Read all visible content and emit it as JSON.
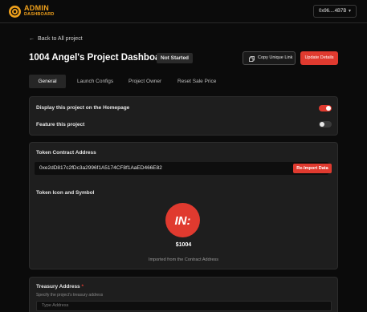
{
  "header": {
    "logo_title": "ADMIN",
    "logo_subtitle": "DASHBOARD",
    "wallet_address": "0x96....4B7B"
  },
  "nav": {
    "back_label": "Back to All project"
  },
  "project": {
    "title": "1004 Angel's Project Dashboard",
    "status": "Not Started",
    "copy_link_label": "Copy Unique Link",
    "update_label": "Update Details"
  },
  "tabs": [
    {
      "label": "General",
      "active": true
    },
    {
      "label": "Launch Configs",
      "active": false
    },
    {
      "label": "Project Owner",
      "active": false
    },
    {
      "label": "Reset Sale Price",
      "active": false
    }
  ],
  "settings": {
    "display_homepage_label": "Display this project on the Homepage",
    "display_homepage_on": true,
    "feature_label": "Feature this project",
    "feature_on": false
  },
  "token": {
    "contract_label": "Token Contract Address",
    "contract_address": "0xe2dD817c2fDc3a2996f1A5174CF8f1AaED466E82",
    "reimport_label": "Re-Import Data",
    "icon_label": "Token Icon and Symbol",
    "logo_text": "IN:",
    "symbol": "$1004",
    "note": "Imported from the Contract Address"
  },
  "treasury": {
    "label": "Treasury Address",
    "required_mark": "*",
    "hint": "Specify the project's treasury address",
    "placeholder": "Type Address"
  },
  "colors": {
    "accent": "#e03a2f",
    "brand": "#f0a11c",
    "panel": "#1e1e1e",
    "background": "#0b0b0b"
  }
}
